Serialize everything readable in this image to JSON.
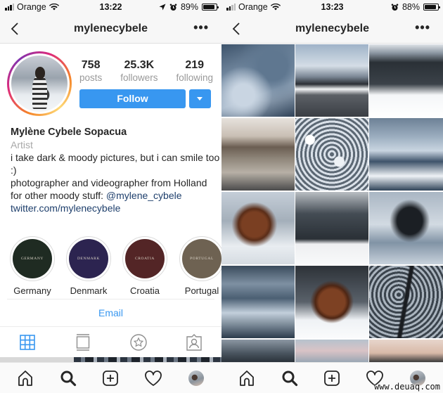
{
  "left_screen": {
    "status_bar": {
      "carrier": "Orange",
      "time": "13:22",
      "battery": "89%",
      "battery_level": 0.89,
      "icons": [
        "signal-icon",
        "wifi-icon",
        "location-arrow-icon",
        "alarm-icon",
        "battery-icon"
      ]
    },
    "nav": {
      "title": "mylenecybele",
      "back_icon": "chevron-left-icon",
      "more_icon": "more-horizontal-icon",
      "more_label": "•••"
    },
    "profile": {
      "stats": [
        {
          "value": "758",
          "label": "posts"
        },
        {
          "value": "25.3K",
          "label": "followers"
        },
        {
          "value": "219",
          "label": "following"
        }
      ],
      "follow_label": "Follow",
      "name": "Mylène Cybele Sopacua",
      "category": "Artist",
      "bio_lines": [
        "i take dark & moody pictures, but i can smile too :)",
        "photographer and videographer from Holland"
      ],
      "bio_mention_prefix": "for other moody stuff: ",
      "bio_mention": "@mylene_cybele",
      "website": "twitter.com/mylenecybele"
    },
    "highlights": [
      {
        "label": "Germany",
        "cover_text": "GERMANY",
        "color": "#1f2b22"
      },
      {
        "label": "Denmark",
        "cover_text": "DENMARK",
        "color": "#2c2450"
      },
      {
        "label": "Croatia",
        "cover_text": "CROATIA",
        "color": "#532526"
      },
      {
        "label": "Portugal",
        "cover_text": "PORTUGAL",
        "color": "#6e6252"
      }
    ],
    "email_label": "Email",
    "profile_tabs": [
      {
        "name": "grid",
        "icon": "grid-icon",
        "active": true
      },
      {
        "name": "feed",
        "icon": "feed-list-icon",
        "active": false
      },
      {
        "name": "guides",
        "icon": "star-circle-icon",
        "active": false
      },
      {
        "name": "tagged",
        "icon": "tagged-person-icon",
        "active": false
      }
    ]
  },
  "right_screen": {
    "status_bar": {
      "carrier": "Orange",
      "time": "13:23",
      "battery": "88%",
      "battery_level": 0.88,
      "icons": [
        "signal-icon",
        "wifi-icon",
        "alarm-icon",
        "battery-icon"
      ]
    },
    "nav": {
      "title": "mylenecybele",
      "back_icon": "chevron-left-icon",
      "more_icon": "more-horizontal-icon",
      "more_label": "•••"
    },
    "photos": [
      {
        "description": "Icy frozen waterfall"
      },
      {
        "description": "Person standing on snowy mountain road"
      },
      {
        "description": "Wooden cabin in snowy forest valley"
      },
      {
        "description": "Canal with buildings at dusk"
      },
      {
        "description": "Aerial snowy forest"
      },
      {
        "description": "Snowy mountain peaks above clouds"
      },
      {
        "description": "Highland cow in snow"
      },
      {
        "description": "Hut in misty pine forest"
      },
      {
        "description": "Crow landing on hand"
      },
      {
        "description": "Dark mountain ridge"
      },
      {
        "description": "Highland cow lying in snow"
      },
      {
        "description": "Aerial winding road through forest"
      },
      {
        "description": "Town rooftops"
      },
      {
        "description": "Pink clouds"
      },
      {
        "description": "Sunset over trees"
      }
    ],
    "watermark": "www.deuaq.com"
  },
  "bottom_tabs": [
    {
      "name": "home",
      "icon": "home-icon"
    },
    {
      "name": "search",
      "icon": "search-icon"
    },
    {
      "name": "new-post",
      "icon": "add-post-icon"
    },
    {
      "name": "activity",
      "icon": "heart-icon"
    },
    {
      "name": "profile",
      "icon": "profile-avatar-icon"
    }
  ],
  "colors": {
    "accent": "#3897f0",
    "link": "#1e3f6c",
    "muted": "#999999"
  }
}
